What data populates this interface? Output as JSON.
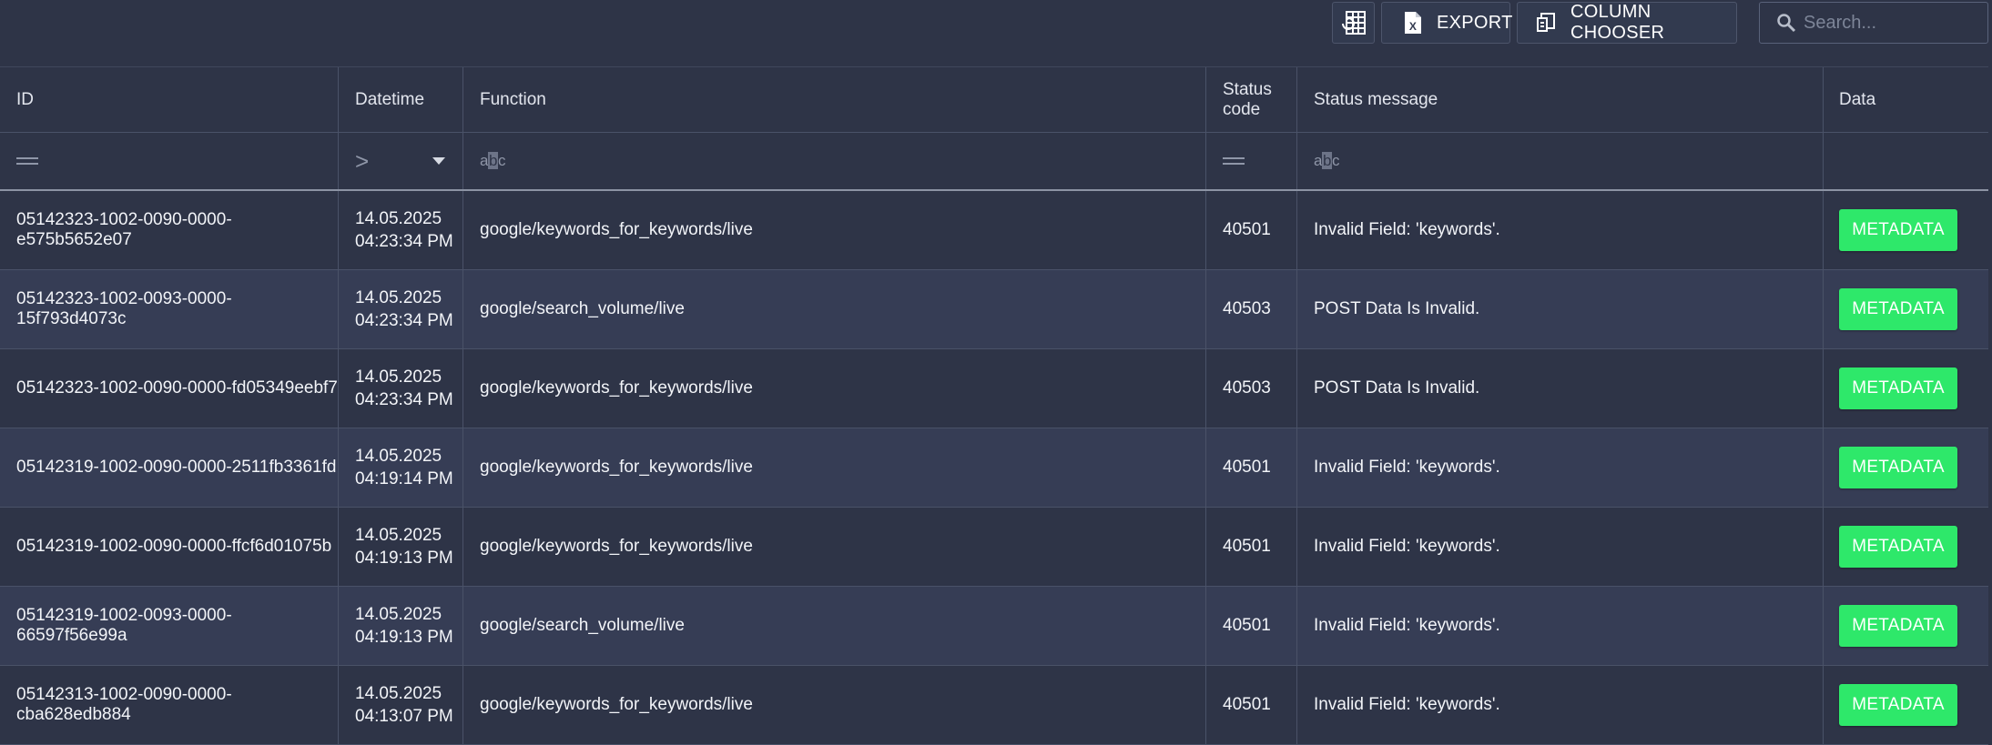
{
  "toolbar": {
    "grid_icon": "table-grid-icon",
    "export_label": "EXPORT",
    "export_icon": "excel-file-icon",
    "column_chooser_label": "COLUMN CHOOSER",
    "column_chooser_icon": "column-chooser-icon",
    "search_placeholder": "Search...",
    "search_icon": "search-icon"
  },
  "table": {
    "columns": [
      "ID",
      "Datetime",
      "Function",
      "Status\ncode",
      "Status message",
      "Data"
    ],
    "filters": {
      "id": "equals-icon",
      "datetime": "greater-than-icon",
      "function": "abc",
      "status_code": "equals-icon",
      "status_message": "abc"
    },
    "button_label": "METADATA",
    "rows": [
      {
        "id": "05142323-1002-0090-0000-e575b5652e07",
        "date": "14.05.2025",
        "time": "04:23:34 PM",
        "function": "google/keywords_for_keywords/live",
        "status_code": "40501",
        "status_message": "Invalid Field: 'keywords'.",
        "data": "METADATA"
      },
      {
        "id": "05142323-1002-0093-0000-15f793d4073c",
        "date": "14.05.2025",
        "time": "04:23:34 PM",
        "function": "google/search_volume/live",
        "status_code": "40503",
        "status_message": "POST Data Is Invalid.",
        "data": "METADATA"
      },
      {
        "id": "05142323-1002-0090-0000-fd05349eebf7",
        "date": "14.05.2025",
        "time": "04:23:34 PM",
        "function": "google/keywords_for_keywords/live",
        "status_code": "40503",
        "status_message": "POST Data Is Invalid.",
        "data": "METADATA"
      },
      {
        "id": "05142319-1002-0090-0000-2511fb3361fd",
        "date": "14.05.2025",
        "time": "04:19:14 PM",
        "function": "google/keywords_for_keywords/live",
        "status_code": "40501",
        "status_message": "Invalid Field: 'keywords'.",
        "data": "METADATA"
      },
      {
        "id": "05142319-1002-0090-0000-ffcf6d01075b",
        "date": "14.05.2025",
        "time": "04:19:13 PM",
        "function": "google/keywords_for_keywords/live",
        "status_code": "40501",
        "status_message": "Invalid Field: 'keywords'.",
        "data": "METADATA"
      },
      {
        "id": "05142319-1002-0093-0000-66597f56e99a",
        "date": "14.05.2025",
        "time": "04:19:13 PM",
        "function": "google/search_volume/live",
        "status_code": "40501",
        "status_message": "Invalid Field: 'keywords'.",
        "data": "METADATA"
      },
      {
        "id": "05142313-1002-0090-0000-cba628edb884",
        "date": "14.05.2025",
        "time": "04:13:07 PM",
        "function": "google/keywords_for_keywords/live",
        "status_code": "40501",
        "status_message": "Invalid Field: 'keywords'.",
        "data": "METADATA"
      }
    ]
  },
  "colors": {
    "background": "#2e3447",
    "alt_row": "#363d55",
    "metadata_button": "#2ee86a"
  }
}
